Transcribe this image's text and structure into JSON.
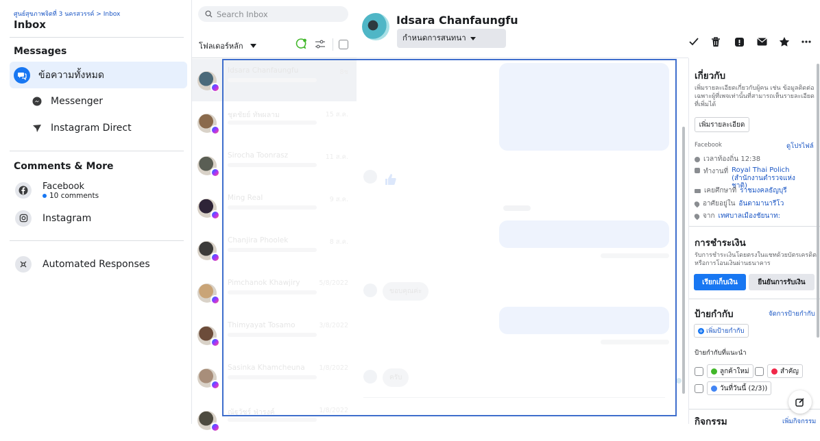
{
  "sidebar": {
    "breadcrumb": "ศูนย์สุขภาพจิตที่ 3 นครสวรรค์ > Inbox",
    "title": "Inbox",
    "messages_heading": "Messages",
    "items": [
      {
        "label": "ข้อความทั้งหมด"
      },
      {
        "label": "Messenger"
      },
      {
        "label": "Instagram Direct"
      }
    ],
    "comments_heading": "Comments & More",
    "facebook": {
      "label": "Facebook",
      "sub": "10 comments"
    },
    "instagram": {
      "label": "Instagram"
    },
    "automated": {
      "label": "Automated Responses"
    }
  },
  "list": {
    "search_placeholder": "Search Inbox",
    "folder_label": "โฟลเดอร์หลัก",
    "conversations": [
      {
        "name": "Idsara Chanfaungfu",
        "time": "8ช"
      },
      {
        "name": "ชุดชัยย์ ทัพผลาม",
        "time": "15 ส.ค."
      },
      {
        "name": "Sirocha Toonrasz",
        "time": "11 ส.ค."
      },
      {
        "name": "Ming Real",
        "time": "9 ส.ค."
      },
      {
        "name": "Chanjira Phoolek",
        "time": "8 ส.ค."
      },
      {
        "name": "Pimchanok Khawjiry",
        "time": "5/8/2022"
      },
      {
        "name": "Thimyayat Tosamo",
        "time": "3/8/2022"
      },
      {
        "name": "Sasinka Khamcheuna",
        "time": "1/8/2022"
      },
      {
        "name": "ณัฐวัชร์ ฟ่ารงค์",
        "time": "1/8/2022"
      }
    ]
  },
  "thread": {
    "contact_name": "Idsara Chanfaungfu",
    "topic_button": "กำหนดการสนทนา",
    "received_reply": "ขอบคุณค่ะ",
    "received_reply2": "ครับ"
  },
  "details": {
    "about_heading": "เกี่ยวกับ",
    "about_desc": "เพิ่มรายละเอียดเกี่ยวกับผู้คน เช่น ข้อมูลติดต่อ เฉพาะผู้ที่เพจเท่านั้นที่สามารถเห็นรายละเอียดที่เพิ่มได้",
    "add_details_btn": "เพิ่มรายละเอียด",
    "fb_label": "Facebook",
    "view_profile": "ดูโปรไฟล์",
    "local_time": "เวลาท้องถิ่น 12:38",
    "work_prefix": "ทำงานที่",
    "work_place": "Royal Thai Polich (สำนักงานตำรวจแห่งชาติ)",
    "studied_prefix": "เคยศึกษาที่",
    "studied_place": "ราชมงคลธัญบุรี",
    "lives_prefix": "อาศัยอยู่ใน",
    "lives_place": "อันดามานารีโว",
    "from_prefix": "จาก",
    "from_place": "เทศบาลเมืองชัยนาท:",
    "payment_heading": "การชำระเงิน",
    "payment_desc": "รับการชำระเงินโดยตรงในแชทด้วยบัตรเครดิตหรือการโอนเงินผ่านธนาคาร",
    "request_btn": "เรียกเก็บเงิน",
    "confirm_btn": "ยืนยันการรับเงิน",
    "labels_heading": "ป้ายกำกับ",
    "manage_labels": "จัดการป้ายกำกับ",
    "add_label": "เพิ่มป้ายกำกับ",
    "suggested": "ป้ายกำกับที่แนะนำ",
    "tags": [
      "ลูกค้าใหม่",
      "สำคัญ",
      "วันที่วันนี้ (2/3))"
    ],
    "activity_heading": "กิจกรรม",
    "add_activity": "เพิ่มกิจกรรม"
  },
  "colors": {
    "accent": "#1877f2",
    "selected_bg": "#e7f0fd",
    "overlay": "#3d6dcc",
    "tag_green": "#42b72a",
    "tag_red": "#f02849",
    "tag_blue": "#4285f4"
  }
}
